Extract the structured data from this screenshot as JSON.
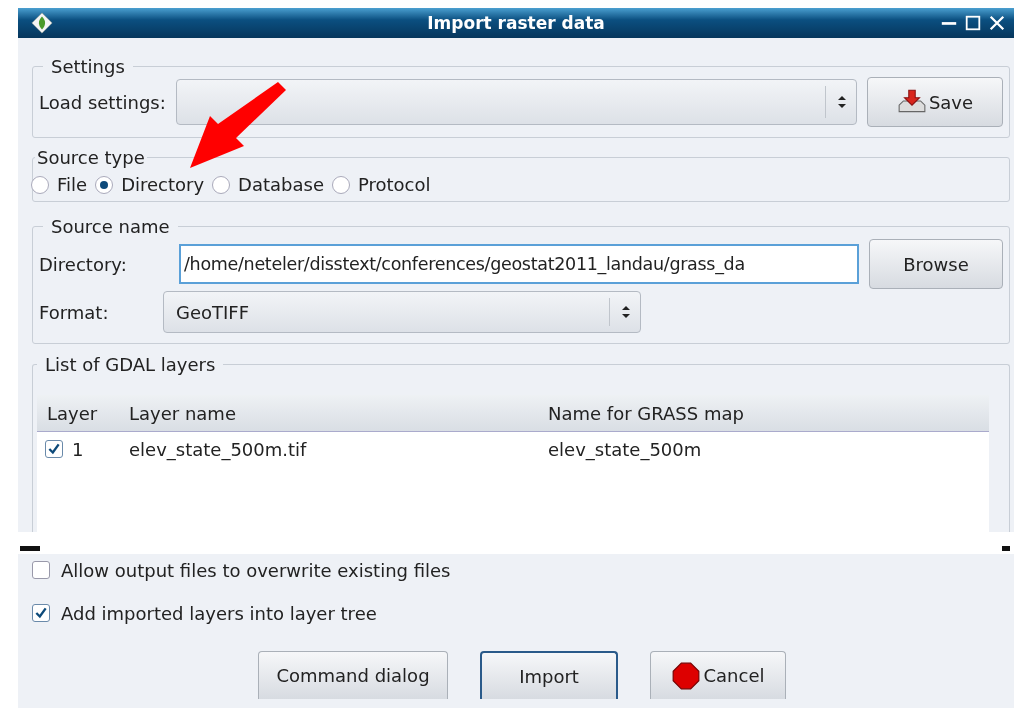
{
  "window": {
    "title": "Import raster data"
  },
  "settings": {
    "legend": "Settings",
    "load_label": "Load settings:",
    "save_button": "Save"
  },
  "source_type": {
    "legend": "Source type",
    "options": [
      {
        "label": "File",
        "selected": false
      },
      {
        "label": "Directory",
        "selected": true
      },
      {
        "label": "Database",
        "selected": false
      },
      {
        "label": "Protocol",
        "selected": false
      }
    ]
  },
  "source_name": {
    "legend": "Source name",
    "directory_label": "Directory:",
    "directory_value": "/home/neteler/disstext/conferences/geostat2011_landau/grass_da",
    "browse_button": "Browse",
    "format_label": "Format:",
    "format_value": "GeoTIFF"
  },
  "layers": {
    "legend": "List of GDAL layers",
    "columns": [
      "Layer",
      "Layer name",
      "Name for GRASS map"
    ],
    "rows": [
      {
        "checked": true,
        "layer": "1",
        "layer_name": "elev_state_500m.tif",
        "grass_name": "elev_state_500m"
      }
    ]
  },
  "options": [
    {
      "label": "Allow output files to overwrite existing files",
      "checked": false
    },
    {
      "label": "Add imported layers into layer tree",
      "checked": true
    }
  ],
  "buttons": [
    {
      "label": "Command dialog",
      "kind": "plain"
    },
    {
      "label": "Import",
      "kind": "default"
    },
    {
      "label": "Cancel",
      "kind": "cancel"
    }
  ]
}
